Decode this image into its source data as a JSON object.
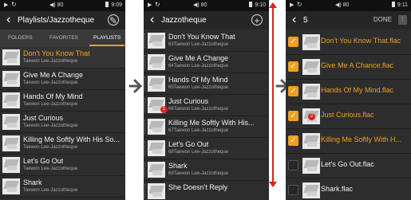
{
  "status": {
    "play": "▶",
    "refresh": "↻",
    "volume": "◀) 80",
    "time1": "9:09",
    "time2": "9:10",
    "time3": "9:11"
  },
  "screen1": {
    "title": "Playlists/Jazzotheque",
    "tabs": [
      "FOLDERS",
      "FAVORITES",
      "PLAYLISTS"
    ],
    "items": [
      {
        "title": "Don't You Know That",
        "artist": "Taewon Lee-Jazzotheque"
      },
      {
        "title": "Give Me A Change",
        "artist": "Taewon Lee-Jazzotheque"
      },
      {
        "title": "Hands Of My Mind",
        "artist": "Taewon Lee-Jazzotheque"
      },
      {
        "title": "Just Curious",
        "artist": "Taewon Lee-Jazzotheque"
      },
      {
        "title": "Killing Me Softly With His So...",
        "artist": "Taewon Lee-Jazzotheque"
      },
      {
        "title": "Let's Go Out",
        "artist": "Taewon Lee-Jazzotheque"
      },
      {
        "title": "Shark",
        "artist": "Taewon Lee-Jazzotheque"
      }
    ]
  },
  "screen2": {
    "title": "Jazzotheque",
    "items": [
      {
        "title": "Don't You Know That",
        "artist": "63Taewon Lee-Jazzotheque"
      },
      {
        "title": "Give Me A Change",
        "artist": "64Taewon Lee-Jazzotheque"
      },
      {
        "title": "Hands Of My Mind",
        "artist": "65Taewon Lee-Jazzotheque"
      },
      {
        "title": "Just Curious",
        "artist": "66Taewon Lee-Jazzotheque"
      },
      {
        "title": "Killing Me Softly With His...",
        "artist": "67Taewon Lee-Jazzotheque"
      },
      {
        "title": "Let's Go Out",
        "artist": "68Taewon Lee-Jazzotheque"
      },
      {
        "title": "Shark",
        "artist": "69Taewon Lee-Jazzotheque"
      },
      {
        "title": "She Doesn't Reply",
        "artist": ""
      }
    ],
    "badge": "1"
  },
  "screen3": {
    "count": "5",
    "done": "DONE",
    "items": [
      {
        "title": "Don't You Know That.flac",
        "checked": true
      },
      {
        "title": "Give Me A Chance.flac",
        "checked": true
      },
      {
        "title": "Hands Of My Mind.flac",
        "checked": true
      },
      {
        "title": "Just Curious.flac",
        "checked": true
      },
      {
        "title": "Killing Me Softly With H...",
        "checked": true
      },
      {
        "title": "Let's Go Out.flac",
        "checked": false
      },
      {
        "title": "Shark.flac",
        "checked": false
      }
    ],
    "badge": "2"
  },
  "colors": {
    "accent": "#f0a020",
    "marker": "#e02020",
    "bg": "#2d2d2d"
  },
  "icons": {
    "back": "chevron-left-icon",
    "edit": "pencil-icon",
    "add": "plus-icon",
    "next": "arrow-right-icon"
  }
}
